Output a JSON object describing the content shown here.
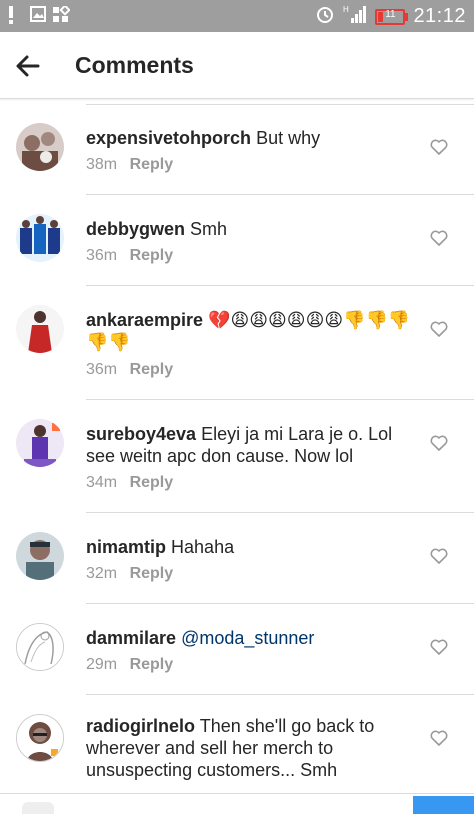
{
  "status_bar": {
    "time": "21:12",
    "battery": "11",
    "network": "H"
  },
  "header": {
    "title": "Comments"
  },
  "reply_label": "Reply",
  "comments": [
    {
      "username": "expensivetohporch",
      "text": "But why",
      "time": "38m",
      "avatar_color": "#8d6e63"
    },
    {
      "username": "debbygwen",
      "text": "Smh",
      "time": "36m",
      "avatar_color": "#1e3a8a"
    },
    {
      "username": "ankaraempire",
      "text": "💔😩😩😩😩😩😩👎👎👎👎👎",
      "time": "36m",
      "avatar_color": "#c62828"
    },
    {
      "username": "sureboy4eva",
      "text": "Eleyi ja mi Lara je o. Lol see weitn apc don cause. Now lol",
      "time": "34m",
      "avatar_color": "#5e35b1"
    },
    {
      "username": "nimamtip",
      "text": "Hahaha",
      "time": "32m",
      "avatar_color": "#546e7a"
    },
    {
      "username": "dammilare",
      "text": "@moda_stunner",
      "time": "29m",
      "avatar_color": "#bdbdbd"
    },
    {
      "username": "radiogirlnelo",
      "text": "Then she'll go back to wherever and sell her merch to unsuspecting customers... Smh",
      "time": "",
      "avatar_color": "#6d4c41"
    }
  ],
  "colors": {
    "status_bar": "#9e9e9e",
    "username": "#262626",
    "meta": "#999999",
    "mention": "#003569",
    "accent": "#3897f0"
  }
}
